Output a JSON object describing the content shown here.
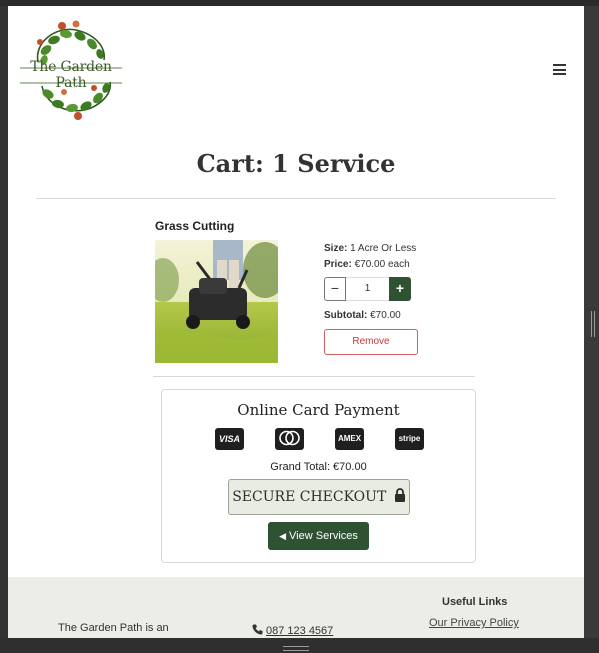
{
  "header": {
    "logo_text": "The Garden Path",
    "menu_icon": "hamburger-icon"
  },
  "cart": {
    "title": "Cart: 1 Service",
    "item": {
      "name": "Grass Cutting",
      "image": "lawn-mower-photo",
      "size_label": "Size:",
      "size_value": "1 Acre Or Less",
      "price_label": "Price:",
      "price_value": "€70.00 each",
      "quantity": "1",
      "minus_symbol": "−",
      "plus_symbol": "+",
      "subtotal_label": "Subtotal:",
      "subtotal_value": "€70.00",
      "remove_label": "Remove"
    }
  },
  "payment": {
    "title": "Online Card Payment",
    "cards": [
      "VISA",
      "mastercard",
      "AMEX",
      "stripe"
    ],
    "grand_total": "Grand Total: €70.00",
    "checkout_label": "SECURE CHECKOUT",
    "view_services_label": "View Services"
  },
  "footer": {
    "about_text": "The Garden Path is an",
    "phone": "087 123 4567",
    "links_title": "Useful Links",
    "privacy_link": "Our Privacy Policy"
  },
  "colors": {
    "brand_green": "#2f5233",
    "remove_red": "#c03a3a",
    "footer_bg": "#ecede6"
  }
}
